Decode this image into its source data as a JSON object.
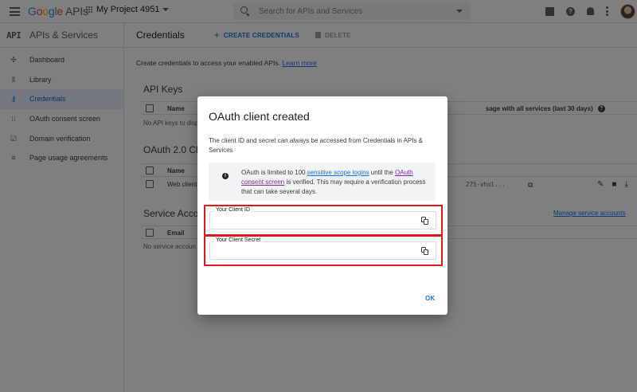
{
  "topbar": {
    "logo_google": [
      "G",
      "o",
      "o",
      "g",
      "l",
      "e"
    ],
    "logo_apis": "APIs",
    "project": "My Project 4951",
    "search_placeholder": "Search for APIs and Services"
  },
  "icons": {
    "menu": "menu-icon",
    "search": "search-icon",
    "gift": "gift-icon",
    "help": "help-icon",
    "bell": "bell-icon",
    "more": "more-vert-icon"
  },
  "sidebar": {
    "logo": "API",
    "title": "APIs & Services",
    "items": [
      {
        "label": "Dashboard",
        "icon": "✣"
      },
      {
        "label": "Library",
        "icon": "⫴"
      },
      {
        "label": "Credentials",
        "icon": "⚷",
        "active": true
      },
      {
        "label": "OAuth consent screen",
        "icon": "⁝⁝"
      },
      {
        "label": "Domain verification",
        "icon": "☑"
      },
      {
        "label": "Page usage agreements",
        "icon": "≡"
      }
    ]
  },
  "main": {
    "title": "Credentials",
    "create_label": "CREATE CREDENTIALS",
    "delete_label": "DELETE",
    "intro": "Create credentials to access your enabled APIs.",
    "learn_more": "Learn more",
    "api_keys": {
      "title": "API Keys",
      "col_name": "Name",
      "col_usage": "sage with all services (last 30 days)",
      "empty": "No API keys to disp"
    },
    "oauth": {
      "title": "OAuth 2.0 Cl",
      "col_name": "Name",
      "row_name": "Web client",
      "row_client_id": "275-vhol..."
    },
    "service": {
      "title": "Service Acco",
      "col_email": "Email",
      "empty": "No service accoun",
      "manage": "Manage service accounts"
    }
  },
  "dialog": {
    "title": "OAuth client created",
    "description": "The client ID and secret can always be accessed from Credentials in APIs & Services",
    "info_pre": "OAuth is limited to 100 ",
    "info_link1": "sensitive scope logins",
    "info_mid": " until the ",
    "info_link2": "OAuth consent screen",
    "info_post": " is verified. This may require a verification process that can take several days.",
    "client_id_label": "Your Client ID",
    "client_id_value": "",
    "client_secret_label": "Your Client Secret",
    "client_secret_value": "",
    "ok_label": "OK"
  },
  "colors": {
    "accent": "#1a73e8",
    "highlight_box": "#e0191e",
    "active_nav_bg": "#e8f0fe"
  }
}
